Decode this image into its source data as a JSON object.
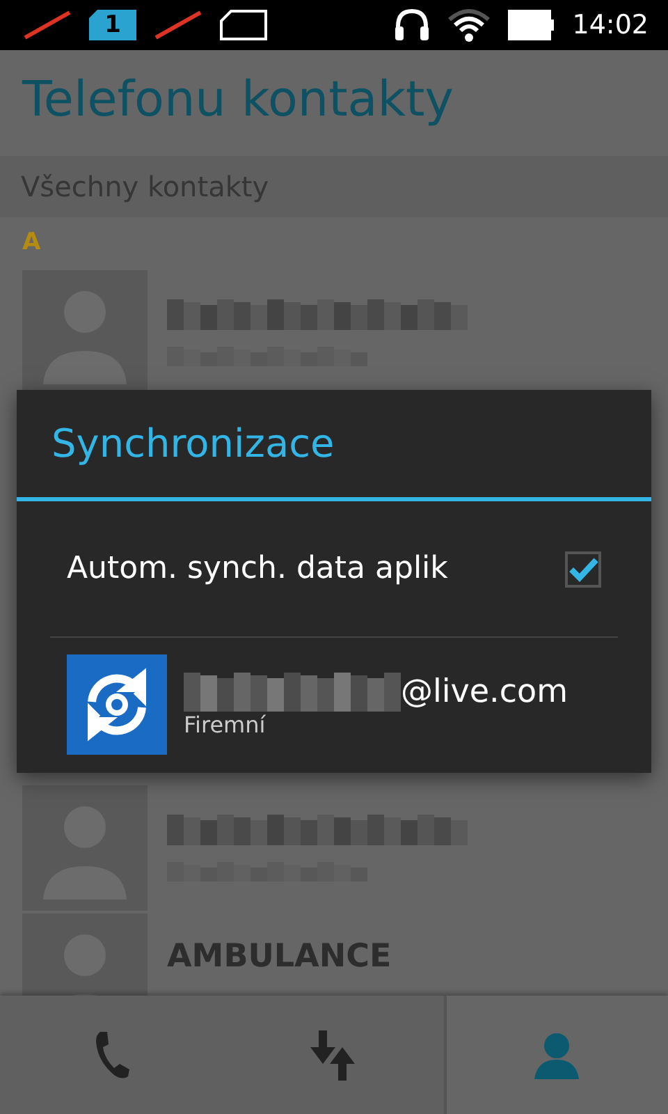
{
  "status_bar": {
    "sim_label": "1",
    "time": "14:02"
  },
  "header": {
    "title": "Telefonu kontakty"
  },
  "filter": {
    "label": "Všechny kontakty"
  },
  "section": {
    "letter": "A"
  },
  "contacts": [
    {
      "kind": "blurred"
    },
    {
      "kind": "blurred"
    },
    {
      "kind": "named",
      "name": "AMBULANCE"
    }
  ],
  "dialog": {
    "title": "Synchronizace",
    "auto_sync": {
      "label": "Autom. synch. data aplik",
      "checked": true
    },
    "account": {
      "email": "@live.com",
      "type": "Firemní"
    }
  },
  "nav": [
    {
      "kind": "phone",
      "selected": false
    },
    {
      "kind": "transfer",
      "selected": false
    },
    {
      "kind": "contacts",
      "selected": true
    }
  ]
}
